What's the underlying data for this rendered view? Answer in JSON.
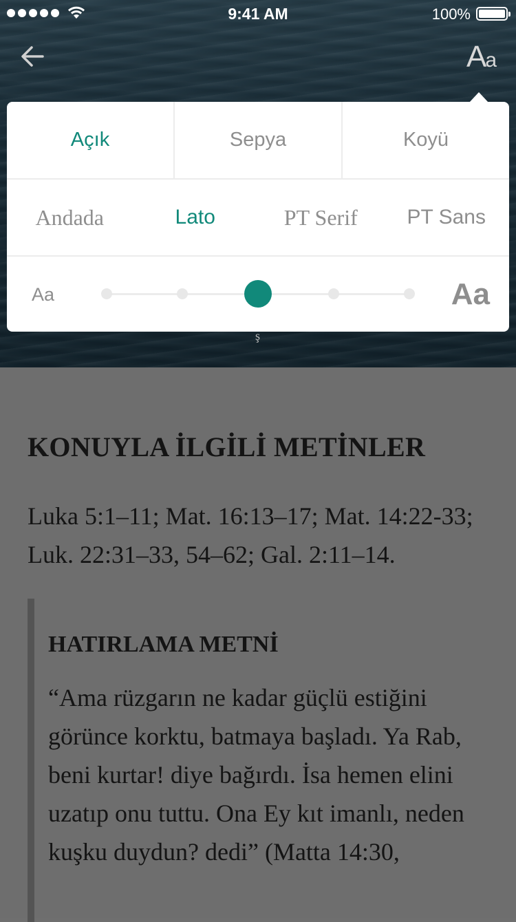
{
  "status": {
    "time": "9:41 AM",
    "battery": "100%"
  },
  "nav": {
    "aa_label_big": "A",
    "aa_label_small": "a"
  },
  "settings": {
    "themes": [
      "Açık",
      "Sepya",
      "Koyü"
    ],
    "active_theme": "Açık",
    "fonts": [
      "Andada",
      "Lato",
      "PT Serif",
      "PT Sans"
    ],
    "active_font": "Lato",
    "size_small_label": "Aa",
    "size_large_label": "Aa",
    "size_level": 3,
    "size_steps": 5,
    "accent": "#11897a"
  },
  "content": {
    "heading": "KONUYLA İLGİLİ METİNLER",
    "references": "Luka 5:1–11; Mat. 16:13–17; Mat. 14:22-33; Luk. 22:31–33, 54–62; Gal. 2:11–14.",
    "memory_heading": "HATIRLAMA METNİ",
    "memory_text": "“Ama rüzgarın ne kadar güçlü estiğini görünce korktu, batmaya başladı. Ya Rab, beni kurtar! diye bağırdı. İsa hemen elini uzatıp onu tuttu. Ona Ey kıt imanlı, neden kuşku duydun? dedi” (Matta 14:30,"
  }
}
